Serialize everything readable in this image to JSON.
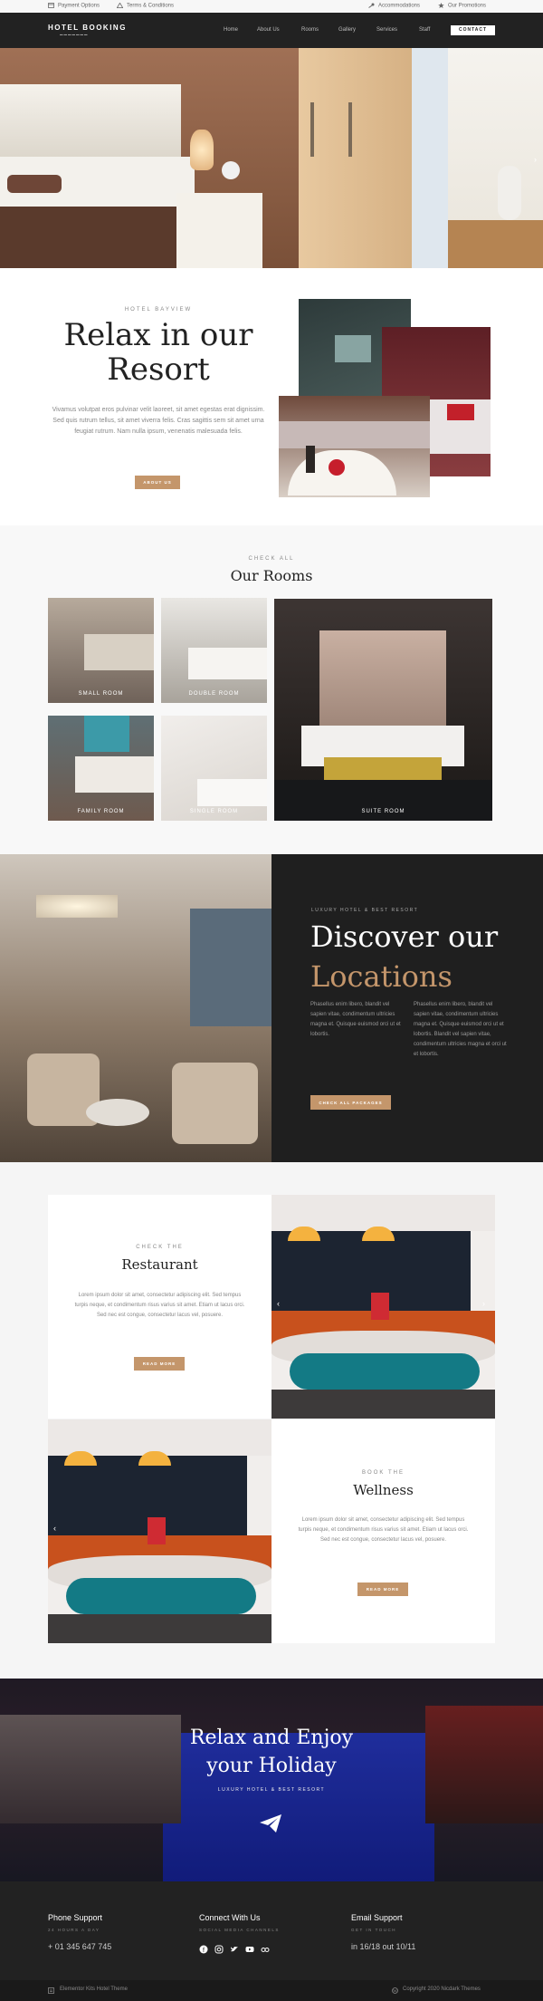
{
  "topbar": {
    "payment": "Payment Options",
    "terms": "Terms & Conditions",
    "accommodations": "Accommodations",
    "promotions": "Our Promotions"
  },
  "header": {
    "logo": "HOTEL BOOKING",
    "nav": [
      "Home",
      "About Us",
      "Rooms",
      "Gallery",
      "Services",
      "Staff"
    ],
    "contact": "CONTACT"
  },
  "about": {
    "eyebrow": "HOTEL BAYVIEW",
    "title_line1": "Relax in our",
    "title_line2": "Resort",
    "text": "Vivamus volutpat eros pulvinar velit laoreet, sit amet egestas erat dignissim. Sed quis rutrum tellus, sit amet viverra felis. Cras sagittis sem sit amet urna feugiat rutrum. Nam nulla ipsum, venenatis malesuada felis.",
    "button": "ABOUT US"
  },
  "rooms": {
    "eyebrow": "CHECK ALL",
    "title": "Our Rooms",
    "items": [
      "SMALL ROOM",
      "DOUBLE ROOM",
      "FAMILY ROOM",
      "SINGLE ROOM",
      "SUITE ROOM"
    ]
  },
  "locations": {
    "eyebrow": "LUXURY HOTEL & BEST RESORT",
    "title_line1": "Discover our",
    "title_line2": "Locations",
    "col1": "Phasellus enim libero, blandit vel sapien vitae, condimentum ultricies magna et. Quisque euismod orci ut et lobortis.",
    "col2": "Phasellus enim libero, blandit vel sapien vitae, condimentum ultricies magna et. Quisque euismod orci ut et lobortis. Blandit vel sapien vitae, condimentum ultricies magna et orci ut et lobortis.",
    "button": "CHECK ALL PACKAGES"
  },
  "restaurant": {
    "eyebrow": "CHECK THE",
    "title": "Restaurant",
    "text": "Lorem ipsum dolor sit amet, consectetur adipiscing elit. Sed tempus turpis neque, et condimentum risus varius sit amet. Etiam ut lacus orci. Sed nec est congue, consectetur lacus vel, posuere.",
    "button": "READ MORE"
  },
  "wellness": {
    "eyebrow": "BOOK THE",
    "title": "Wellness",
    "text": "Lorem ipsum dolor sit amet, consectetur adipiscing elit. Sed tempus turpis neque, et condimentum risus varius sit amet. Etiam ut lacus orci. Sed nec est congue, consectetur lacus vel, posuere.",
    "button": "READ MORE"
  },
  "holiday": {
    "title_line1": "Relax and Enjoy",
    "title_line2": "your Holiday",
    "subtitle": "LUXURY HOTEL & BEST RESORT"
  },
  "footer": {
    "phone_title": "Phone Support",
    "phone_sub": "24 HOURS A DAY",
    "phone": "+ 01 345 647 745",
    "connect_title": "Connect With Us",
    "connect_sub": "SOCIAL MEDIA CHANNELS",
    "email_title": "Email Support",
    "email_sub": "GET IN TOUCH",
    "email": "in 16/18 out 10/11",
    "theme": "Elementor Kits Hotel Theme",
    "copyright": "Copyright 2020 Nicdark Themes"
  },
  "icons": [
    "card-icon",
    "triangle-warning-icon",
    "key-icon",
    "star-icon",
    "arrow-right-icon",
    "arrow-left-icon",
    "paper-plane-icon",
    "facebook-icon",
    "instagram-icon",
    "twitter-icon",
    "youtube-icon",
    "tripadvisor-icon",
    "document-icon",
    "wordpress-icon"
  ],
  "colors": {
    "accent": "#c4966b",
    "dark": "#222222"
  }
}
